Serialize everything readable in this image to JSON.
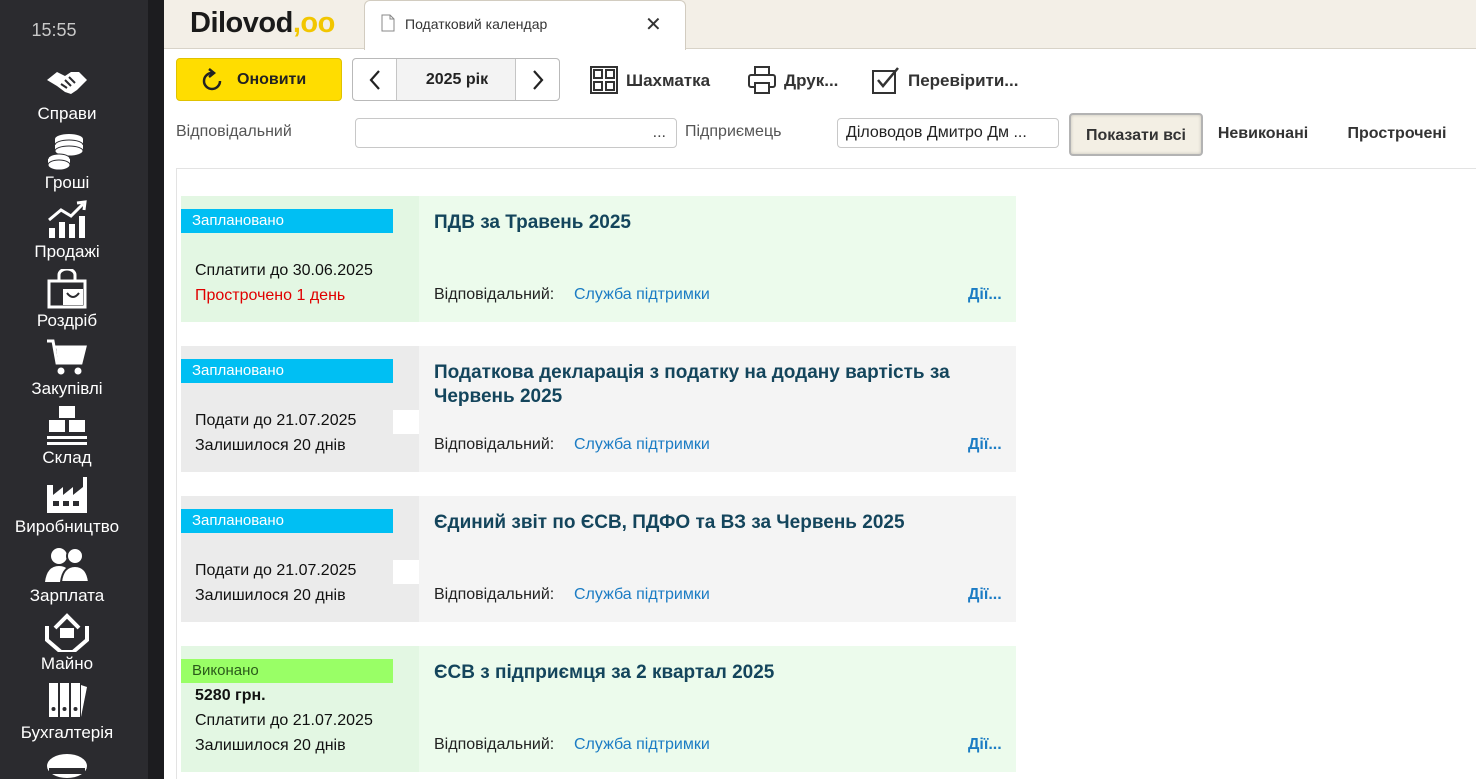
{
  "sidebar": {
    "clock": "15:55",
    "items": [
      {
        "label": "Справи",
        "icon": "handshake-icon"
      },
      {
        "label": "Гроші",
        "icon": "coins-icon"
      },
      {
        "label": "Продажі",
        "icon": "sales-chart-icon"
      },
      {
        "label": "Роздріб",
        "icon": "shopping-bag-icon"
      },
      {
        "label": "Закупівлі",
        "icon": "shopping-cart-icon"
      },
      {
        "label": "Склад",
        "icon": "warehouse-boxes-icon"
      },
      {
        "label": "Виробництво",
        "icon": "factory-icon"
      },
      {
        "label": "Зарплата",
        "icon": "people-icon"
      },
      {
        "label": "Майно",
        "icon": "property-hands-icon"
      },
      {
        "label": "Бухгалтерія",
        "icon": "binders-icon"
      }
    ]
  },
  "header": {
    "logo_text": "Dilovod",
    "logo_accent": ",oo",
    "tab_title": "Податковий календар",
    "tab_close": "✕"
  },
  "toolbar": {
    "refresh_label": "Оновити",
    "year_label": "2025 рік",
    "grid_label": "Шахматка",
    "print_label": "Друк...",
    "check_label": "Перевірити..."
  },
  "filters": {
    "responsible_label": "Відповідальний",
    "responsible_value": "",
    "responsible_dots": "...",
    "entrepreneur_label": "Підприємець",
    "entrepreneur_value": "Діловодов Дмитро Дм ...",
    "show_all": "Показати всі",
    "unfinished": "Невиконані",
    "overdue": "Прострочені"
  },
  "cards": [
    {
      "status": "Заплановано",
      "status_kind": "planned",
      "amount": "",
      "deadline": "Сплатити до 30.06.2025",
      "remaining": "Прострочено 1 день",
      "title": "ПДВ за Травень 2025",
      "responsible_label": "Відповідальний:",
      "responsible": "Служба підтримки",
      "actions": "Дії..."
    },
    {
      "status": "Заплановано",
      "status_kind": "planned",
      "amount": "",
      "deadline": "Подати до 21.07.2025",
      "remaining": "Залишилося 20 днів",
      "title": "Податкова декларація з податку на додану вартість  за Червень 2025",
      "responsible_label": "Відповідальний:",
      "responsible": "Служба підтримки",
      "actions": "Дії..."
    },
    {
      "status": "Заплановано",
      "status_kind": "planned",
      "amount": "",
      "deadline": "Подати до 21.07.2025",
      "remaining": "Залишилося 20 днів",
      "title": "Єдиний звіт по ЄСВ, ПДФО та ВЗ за Червень 2025",
      "responsible_label": "Відповідальний:",
      "responsible": "Служба підтримки",
      "actions": "Дії..."
    },
    {
      "status": "Виконано",
      "status_kind": "done",
      "amount": "5280 грн.",
      "deadline": "Сплатити до 21.07.2025",
      "remaining": "Залишилося 20 днів",
      "title": "ЄСВ з підприємця за 2 квартал 2025",
      "responsible_label": "Відповідальний:",
      "responsible": "Служба підтримки",
      "actions": "Дії..."
    }
  ],
  "colors": {
    "accent_yellow": "#ffdd00",
    "planned_blue": "#00bff3",
    "done_green": "#99ff66",
    "overdue_red": "#e00000",
    "link_blue": "#1b7cc4",
    "sidebar_bg": "#2b2b2f"
  }
}
